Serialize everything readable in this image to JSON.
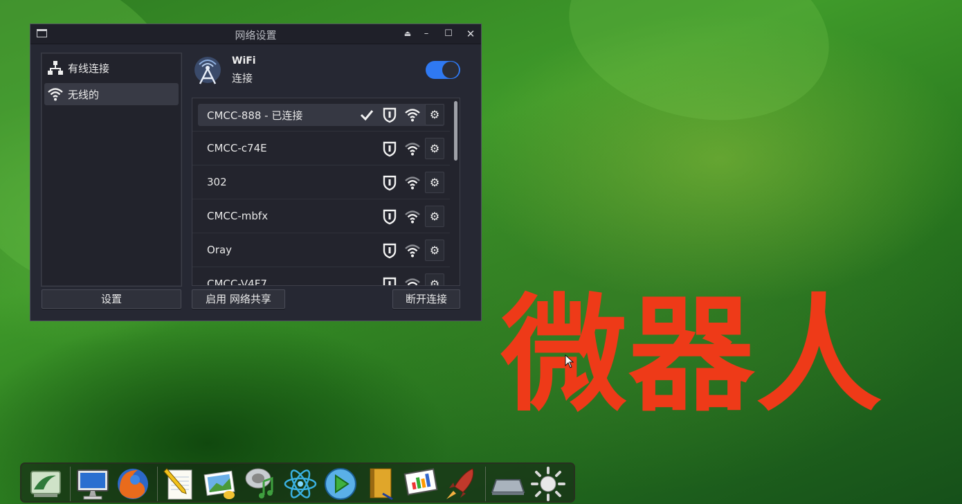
{
  "window": {
    "title": "网络设置"
  },
  "sidebar": {
    "items": [
      {
        "label": "有线连接",
        "icon": "wired-network-icon",
        "active": false
      },
      {
        "label": "无线的",
        "icon": "wifi-icon",
        "active": true
      }
    ]
  },
  "wifi": {
    "name": "WiFi",
    "status": "连接",
    "enabled": true
  },
  "networks": [
    {
      "name": "CMCC-888 - 已连接",
      "connected": true,
      "secured": true
    },
    {
      "name": "CMCC-c74E",
      "connected": false,
      "secured": true
    },
    {
      "name": "302",
      "connected": false,
      "secured": true
    },
    {
      "name": "CMCC-mbfx",
      "connected": false,
      "secured": true
    },
    {
      "name": "Oray",
      "connected": false,
      "secured": true
    },
    {
      "name": "CMCC-V4F7",
      "connected": false,
      "secured": true
    }
  ],
  "buttons": {
    "settings": "设置",
    "hotspot": "启用 网络共享",
    "disconnect": "断开连接"
  },
  "overlay": {
    "text": "微器人"
  },
  "dock": {
    "items": [
      "install-icon",
      "monitor-icon",
      "browser-icon",
      "notepad-icon",
      "image-viewer-icon",
      "music-icon",
      "atom-icon",
      "media-player-icon",
      "notebook-icon",
      "presentation-icon",
      "rocket-icon",
      "drive-icon",
      "brightness-icon"
    ]
  },
  "colors": {
    "accent": "#2f79f2",
    "overlay_text": "#ee3a18",
    "window_bg": "#262833"
  }
}
